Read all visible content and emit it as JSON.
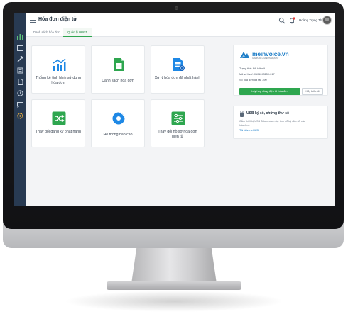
{
  "app": {
    "title": "Hóa đơn điện tử",
    "user_name": "Hoàng Trọng Thắng"
  },
  "tabs": [
    {
      "label": "Danh sách hóa đơn",
      "active": false
    },
    {
      "label": "Quản lý HĐĐT",
      "active": true
    }
  ],
  "sidebar": {
    "icons": [
      "chart-icon",
      "calendar-icon",
      "gavel-icon",
      "invoice-stack-icon",
      "document-icon",
      "clock-icon",
      "chat-icon",
      "gear-icon"
    ]
  },
  "cards": [
    {
      "label": "Thống kê tình hình sử dụng hóa đơn",
      "icon": "line-chart-icon",
      "color": "#1e88e5"
    },
    {
      "label": "Danh sách hóa đơn",
      "icon": "invoice-list-icon",
      "color": "#2ea64f"
    },
    {
      "label": "Xử lý hóa đơn đã phát hành",
      "icon": "invoice-process-icon",
      "color": "#1e88e5"
    },
    {
      "label": "Thay đổi đăng ký phát hành",
      "icon": "shuffle-icon",
      "color": "#2ea64f"
    },
    {
      "label": "Hệ thống báo cáo",
      "icon": "pie-chart-icon",
      "color": "#1e88e5"
    },
    {
      "label": "Thay đổi hồ sơ hóa đơn điện tử",
      "icon": "sliders-icon",
      "color": "#2ea64f"
    }
  ],
  "provider_panel": {
    "brand": "meinvoice.vn",
    "tagline": "GIẢI PHÁP HÓA ĐƠN ĐIỆN TỬ",
    "status_line": "Trạng thái: Đã kết nối",
    "tax_code_line": "Mã số thuế: 0101243150-017",
    "count_line": "Số hóa đơn đã tải: 390",
    "primary_button": "Lấy hợp đồng điện tử hóa đơn",
    "secondary_button": "Hủy kết nối"
  },
  "usb_panel": {
    "title": "USB ký số, chứng thư số",
    "description": "Cắm thiết bị USB Token vào máy tính để ký điện tử các hóa đơn.",
    "link": "Tải driver eHUD"
  },
  "colors": {
    "sidebar": "#283a52",
    "accent_green": "#2ea64f",
    "accent_blue": "#1e88e5"
  }
}
